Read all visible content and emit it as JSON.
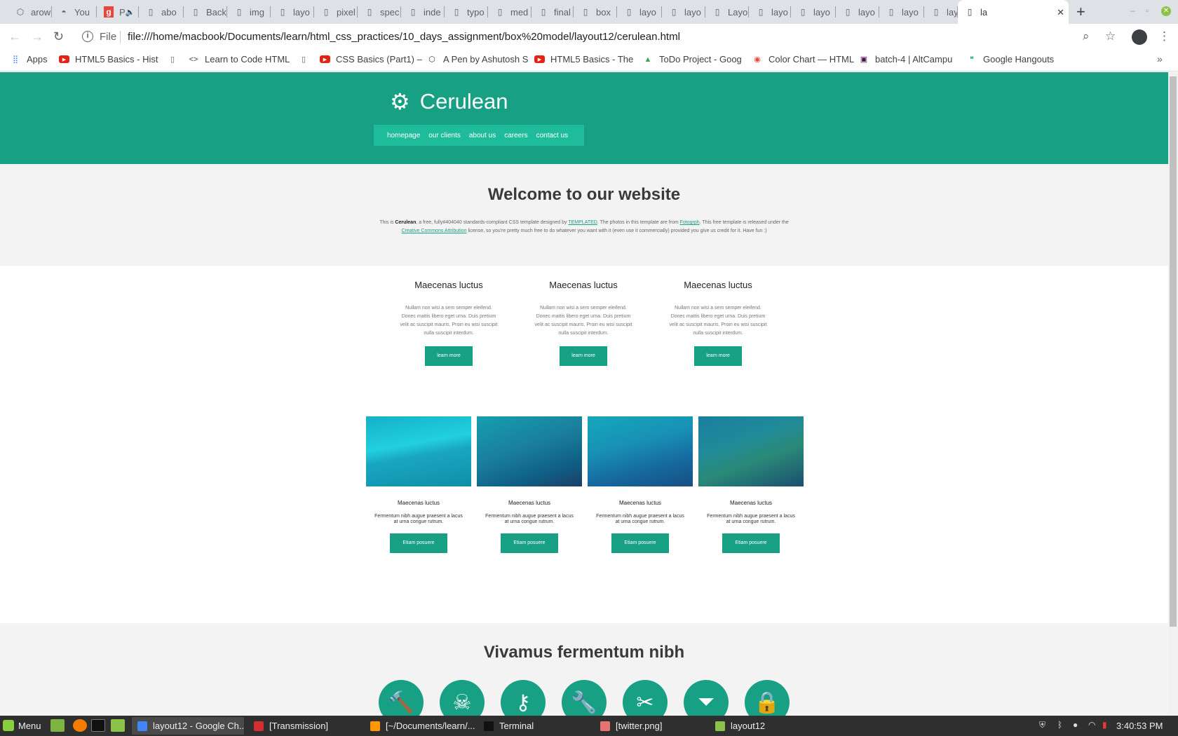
{
  "browser": {
    "tabs": [
      {
        "title": "arow",
        "icon": "codepen-icon"
      },
      {
        "title": "You",
        "icon": "incognito-icon"
      },
      {
        "title": "P",
        "icon": "g-icon"
      },
      {
        "title": "abo",
        "icon": "page-icon"
      },
      {
        "title": "Back",
        "icon": "page-icon"
      },
      {
        "title": "img",
        "icon": "page-icon"
      },
      {
        "title": "layo",
        "icon": "page-icon"
      },
      {
        "title": "pixel",
        "icon": "page-icon"
      },
      {
        "title": "spec",
        "icon": "page-icon"
      },
      {
        "title": "inde",
        "icon": "page-icon"
      },
      {
        "title": "typo",
        "icon": "page-icon"
      },
      {
        "title": "med",
        "icon": "page-icon"
      },
      {
        "title": "final",
        "icon": "page-icon"
      },
      {
        "title": "box",
        "icon": "page-icon"
      },
      {
        "title": "layo",
        "icon": "page-icon"
      },
      {
        "title": "layo",
        "icon": "page-icon"
      },
      {
        "title": "Layo",
        "icon": "page-icon"
      },
      {
        "title": "layo",
        "icon": "page-icon"
      },
      {
        "title": "layo",
        "icon": "page-icon"
      },
      {
        "title": "layo",
        "icon": "page-icon"
      },
      {
        "title": "layo",
        "icon": "page-icon"
      },
      {
        "title": "layo",
        "icon": "page-icon"
      },
      {
        "title": "la",
        "icon": "page-icon",
        "active": true
      }
    ],
    "url_scheme": "File",
    "url": "file:///home/macbook/Documents/learn/html_css_practices/10_days_assignment/box%20model/layout12/cerulean.html",
    "bookmarks": [
      {
        "label": "Apps",
        "icon": "apps-grid-icon"
      },
      {
        "label": "HTML5 Basics - Hist",
        "icon": "youtube-icon"
      },
      {
        "label": "",
        "icon": "page-icon"
      },
      {
        "label": "Learn to Code HTML",
        "icon": "code-icon"
      },
      {
        "label": "",
        "icon": "page-icon"
      },
      {
        "label": "CSS Basics (Part1) –",
        "icon": "youtube-icon"
      },
      {
        "label": "A Pen by Ashutosh S",
        "icon": "codepen-icon"
      },
      {
        "label": "HTML5 Basics - The",
        "icon": "youtube-icon"
      },
      {
        "label": "ToDo Project - Goog",
        "icon": "drive-icon"
      },
      {
        "label": "Color Chart — HTML",
        "icon": "colorchart-icon"
      },
      {
        "label": "batch-4 | AltCampu",
        "icon": "slack-icon"
      },
      {
        "label": "Google Hangouts",
        "icon": "hangouts-icon"
      }
    ]
  },
  "site": {
    "logo_text": "Cerulean",
    "nav": [
      "homepage",
      "our clients",
      "about us",
      "careers",
      "contact us"
    ],
    "welcome_title": "Welcome to our website",
    "welcome_text": {
      "p1": "This is ",
      "brand": "Cerulean",
      "p2": ", a free, fully#404040 standards-compliant CSS template designed by ",
      "link1": "TEMPLATED",
      "p3": ". The photos in this template are from ",
      "link2": "Fotogrph",
      "p4": ". This free template is released under the ",
      "link3": "Creative Commons Attribution",
      "p5": " license, so you're pretty much free to do whatever you want with it (even use it commercially) provided you give us credit for it. Have fun :)"
    },
    "features": [
      {
        "title": "Maecenas luctus",
        "text": "Nullam non wisi a sem semper eleifend. Donec mattis libero eget urna. Duis pretium velit ac suscipit mauris. Proin eu wisi suscipit nulla suscipit interdum.",
        "button": "learn more"
      },
      {
        "title": "Maecenas luctus",
        "text": "Nullam non wisi a sem semper eleifend. Donec mattis libero eget urna. Duis pretium velit ac suscipit mauris. Proin eu wisi suscipit nulla suscipit interdum.",
        "button": "learn more"
      },
      {
        "title": "Maecenas luctus",
        "text": "Nullam non wisi a sem semper eleifend. Donec mattis libero eget urna. Duis pretium velit ac suscipit mauris. Proin eu wisi suscipit nulla suscipit interdum.",
        "button": "learn more"
      }
    ],
    "cards": [
      {
        "title": "Maecenas luctus",
        "text": "Fermentum nibh augue praesent a lacus at urna congue rutrum.",
        "button": "Etiam posuere"
      },
      {
        "title": "Maecenas luctus",
        "text": "Fermentum nibh augue praesent a lacus at urna congue rutrum.",
        "button": "Etiam posuere"
      },
      {
        "title": "Maecenas luctus",
        "text": "Fermentum nibh augue praesent a lacus at urna congue rutrum.",
        "button": "Etiam posuere"
      },
      {
        "title": "Maecenas luctus",
        "text": "Fermentum nibh augue praesent a lacus at urna congue rutrum.",
        "button": "Etiam posuere"
      }
    ],
    "section2_title": "Vivamus fermentum nibh",
    "icon_circles": [
      "gavel-icon",
      "skull-crossbones-icon",
      "key-icon",
      "wrench-icon",
      "scissors-icon",
      "filter-icon",
      "lock-icon"
    ],
    "colors": {
      "accent": "#18a085",
      "nav_bg": "#1fbc9c",
      "section_bg": "#f3f3f3"
    }
  },
  "taskbar": {
    "menu_label": "Menu",
    "windows": [
      {
        "label": "layout12 - Google Ch...",
        "icon": "chrome-icon",
        "active": true
      },
      {
        "label": "[Transmission]",
        "icon": "transmission-icon"
      },
      {
        "label": "[~/Documents/learn/...",
        "icon": "sublime-icon"
      },
      {
        "label": "Terminal",
        "icon": "terminal-icon"
      },
      {
        "label": "[twitter.png]",
        "icon": "image-viewer-icon"
      },
      {
        "label": "layout12",
        "icon": "folder-icon"
      }
    ],
    "clock": "3:40:53 PM"
  }
}
